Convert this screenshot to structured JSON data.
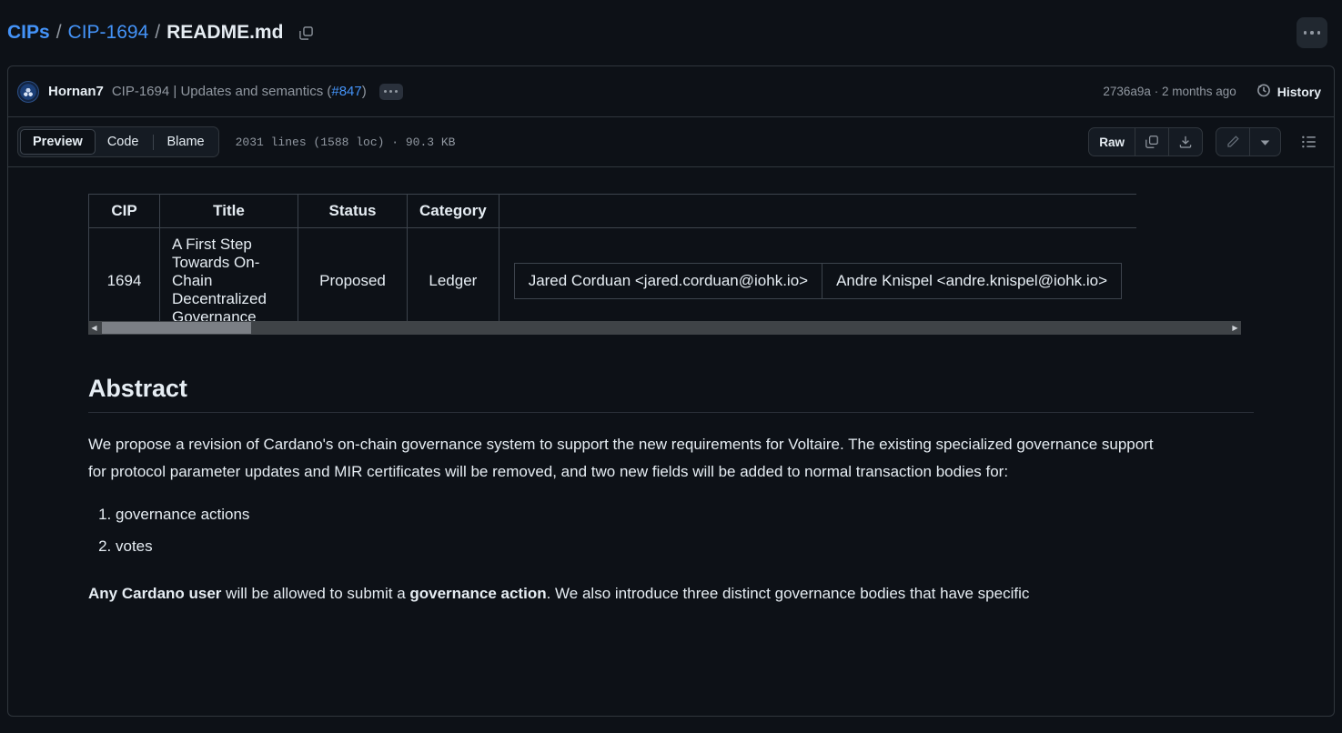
{
  "breadcrumb": {
    "repo_label": "CIPs",
    "folder_label": "CIP-1694",
    "file_label": "README.md",
    "separator": "/",
    "copy_icon": "copy-path-icon"
  },
  "header_actions": {
    "more_options_label": "more-options"
  },
  "commit": {
    "author": "Hornan7",
    "message_prefix": "CIP-1694 | Updates and semantics (",
    "pr_number": "#847",
    "message_suffix": ")",
    "expand_label": "expand-commit-message",
    "sha": "2736a9a",
    "separator": "·",
    "relative_time": "2 months ago",
    "history_label": "History",
    "history_icon": "clock-history-icon"
  },
  "file_toolbar": {
    "tabs": [
      {
        "label": "Preview",
        "active": true
      },
      {
        "label": "Code",
        "active": false
      },
      {
        "label": "Blame",
        "active": false
      }
    ],
    "file_meta": "2031 lines (1588 loc) · 90.3 KB",
    "raw_label": "Raw",
    "copy_icon": "copy-raw-icon",
    "download_icon": "download-icon",
    "edit_icon": "pencil-edit-icon",
    "edit_dropdown_icon": "chevron-down-icon",
    "outline_icon": "symbols-outline-icon"
  },
  "document": {
    "table": {
      "headers": [
        "CIP",
        "Title",
        "Status",
        "Category",
        ""
      ],
      "rows": [
        {
          "cip": "1694",
          "title": "A First Step Towards On-Chain Decentralized Governance",
          "status": "Proposed",
          "category": "Ledger",
          "authors": [
            "Jared Corduan <jared.corduan@iohk.io>",
            "Andre Knispel <andre.knispel@iohk.io>"
          ]
        }
      ],
      "scrollbar": {
        "thumb_percent": 13,
        "position": "left"
      }
    },
    "abstract_heading": "Abstract",
    "abstract_paragraph": "We propose a revision of Cardano's on-chain governance system to support the new requirements for Voltaire. The existing specialized governance support for protocol parameter updates and MIR certificates will be removed, and two new fields will be added to normal transaction bodies for:",
    "list_items": [
      "governance actions",
      "votes"
    ],
    "closing_paragraph": {
      "bold_1": "Any Cardano user",
      "mid_1": " will be allowed to submit a ",
      "bold_2": "governance action",
      "tail": ". We also introduce three distinct governance bodies that have specific"
    }
  },
  "colors": {
    "background": "#0d1117",
    "border": "#30363d",
    "link": "#4493f8",
    "muted_text": "#9198a1",
    "text": "#e6edf3"
  }
}
